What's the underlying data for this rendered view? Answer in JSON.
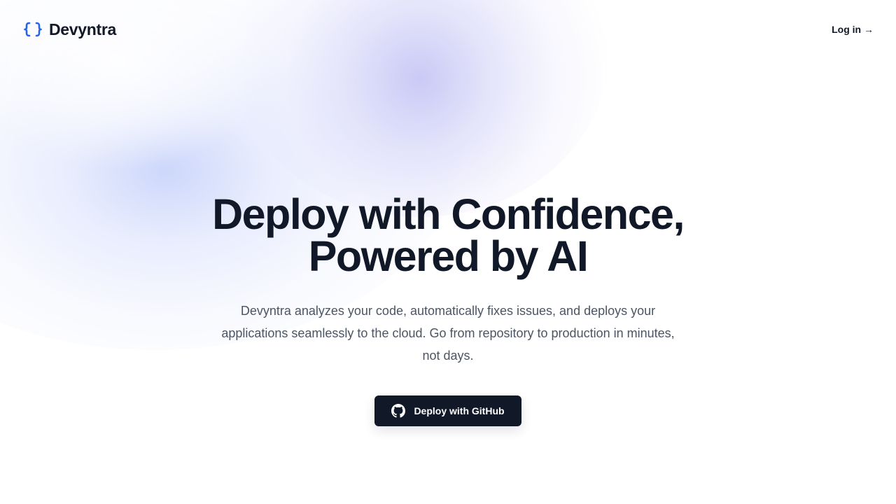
{
  "header": {
    "brand_name": "Devyntra",
    "login_label": "Log in →"
  },
  "hero": {
    "title_line1": "Deploy with Confidence,",
    "title_line2": "Powered by AI",
    "subtitle": "Devyntra analyzes your code, automatically fixes issues, and deploys your applications seamlessly to the cloud. Go from repository to production in minutes, not days.",
    "cta_label": "Deploy with GitHub"
  },
  "icons": {
    "brand": "curly-braces-icon",
    "cta": "github-icon"
  },
  "colors": {
    "accent": "#2563eb",
    "text_primary": "#111827",
    "text_secondary": "#4b5563",
    "button_bg": "#111827"
  }
}
